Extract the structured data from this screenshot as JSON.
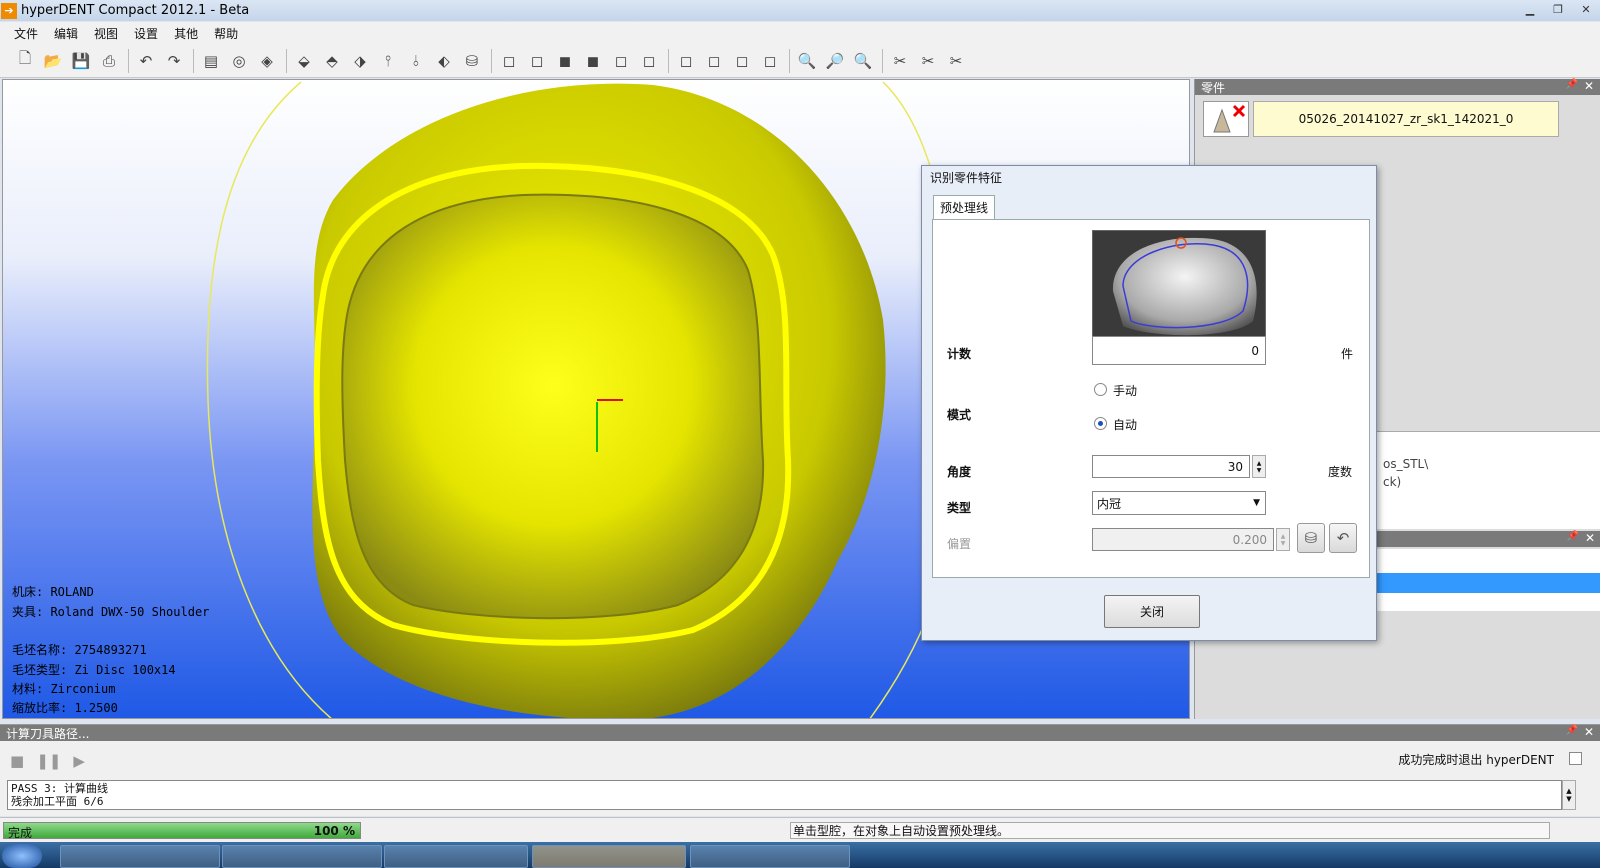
{
  "window": {
    "title": "hyperDENT Compact 2012.1 - Beta",
    "app_icon": "arrow-right-icon"
  },
  "menu": [
    "文件",
    "编辑",
    "视图",
    "设置",
    "其他",
    "帮助"
  ],
  "viewport": {
    "info": {
      "machine": "机床: ROLAND",
      "fixture": "夹具: Roland DWX-50 Shoulder",
      "blank_name": "毛坯名称: 2754893271",
      "blank_type": "毛坯类型: Zi Disc 100x14",
      "material": "材料: Zirconium",
      "scale": "缩放比率: 1.2500"
    },
    "model_color": "#e6e600",
    "margin_line_color": "#ffff00"
  },
  "parts_panel": {
    "title": "零件",
    "part_name": "05026_20141027_zr_sk1_142021_0",
    "partial_lines": [
      "os_STL\\",
      "ck)"
    ]
  },
  "dialog": {
    "title": "识别零件特征",
    "tab": "预处理线",
    "count": {
      "label": "计数",
      "value": "0",
      "unit": "件"
    },
    "mode": {
      "label": "模式",
      "options": [
        "手动",
        "自动"
      ],
      "selected": "自动"
    },
    "angle": {
      "label": "角度",
      "value": "30",
      "unit": "度数"
    },
    "type": {
      "label": "类型",
      "value": "内冠"
    },
    "offset": {
      "label": "偏置",
      "value": "0.200"
    },
    "close_label": "关闭"
  },
  "bottom_panel": {
    "title": "计算刀具路径...",
    "exit_checkbox_label": "成功完成时退出 hyperDENT",
    "log_lines": [
      "PASS 3: 计算曲线",
      "残余加工平面 6/6"
    ]
  },
  "status": {
    "progress_label": "完成",
    "progress_value": "100",
    "progress_unit": "%",
    "progress_fraction": 1.0,
    "message": "单击型腔，在对象上自动设置预处理线。"
  }
}
